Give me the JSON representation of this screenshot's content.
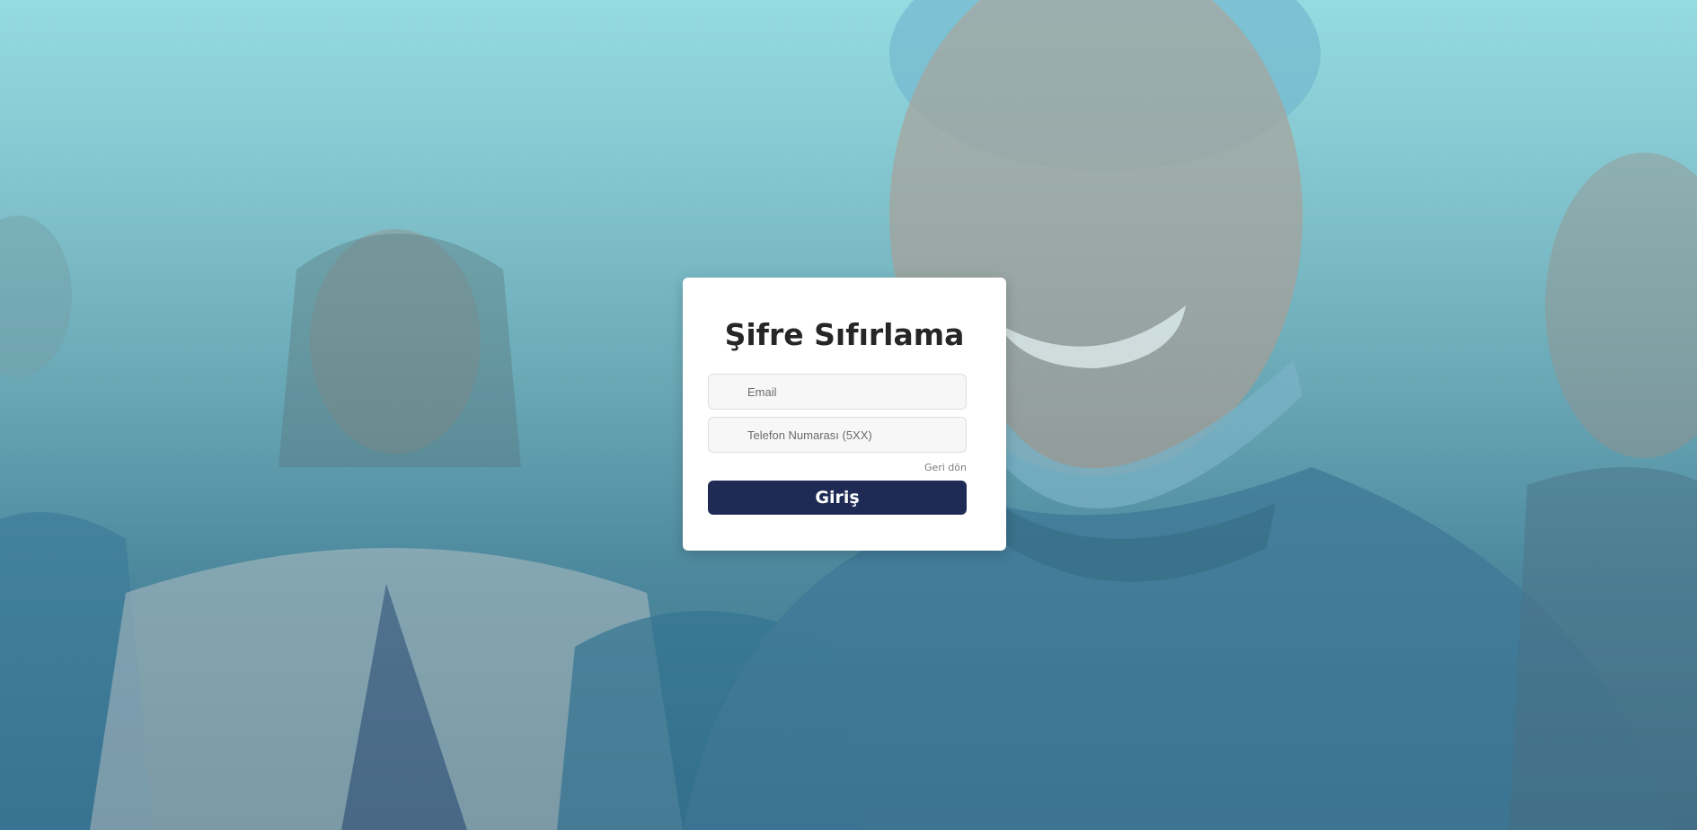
{
  "page": {
    "title": "Şifre Sıfırlama"
  },
  "form": {
    "email_placeholder": "Email",
    "email_value": "",
    "phone_placeholder": "Telefon Numarası (5XX)",
    "phone_value": "",
    "back_link": "Geri dön",
    "submit_label": "Giriş"
  },
  "colors": {
    "primary": "#1f2b55",
    "card_background": "#ffffff",
    "background_tint": "#6ea8b5"
  }
}
